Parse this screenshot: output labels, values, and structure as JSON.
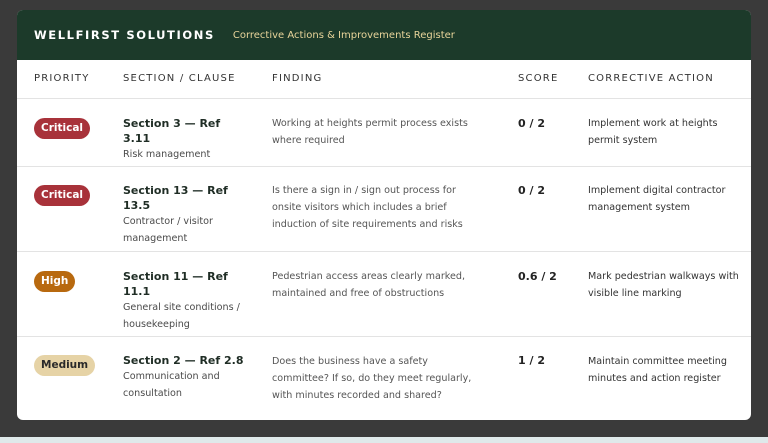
{
  "header": {
    "brand": "WELLFIRST SOLUTIONS",
    "subtitle": "Corrective Actions & Improvements Register"
  },
  "columns": {
    "priority": "PRIORITY",
    "section": "SECTION / CLAUSE",
    "finding": "FINDING",
    "score": "SCORE",
    "action": "CORRECTIVE ACTION"
  },
  "rows": [
    {
      "priority": "Critical",
      "section_title": "Section 3 — Ref 3.11",
      "section_sub": "Risk management",
      "finding": "Working at heights permit process exists where required",
      "score": "0 / 2",
      "action": "Implement work at heights permit system"
    },
    {
      "priority": "Critical",
      "section_title": "Section 13 — Ref 13.5",
      "section_sub": "Contractor / visitor management",
      "finding": "Is there a sign in / sign out process for onsite visitors which includes a brief induction of site requirements and risks",
      "score": "0 / 2",
      "action": "Implement digital contractor management system"
    },
    {
      "priority": "High",
      "section_title": "Section 11 — Ref 11.1",
      "section_sub": "General site conditions / housekeeping",
      "finding": "Pedestrian access areas clearly marked, maintained and free of obstructions",
      "score": "0.6 / 2",
      "action": "Mark pedestrian walkways with visible line marking"
    },
    {
      "priority": "Medium",
      "section_title": "Section 2 — Ref 2.8",
      "section_sub": "Communication and consultation",
      "finding": "Does the business have a safety committee? If so, do they meet regularly, with minutes recorded and shared?",
      "score": "1 / 2",
      "action": "Maintain committee meeting minutes and action register"
    }
  ],
  "colors": {
    "header_bg": "#1c3a2a",
    "critical": "#a8323a",
    "high": "#b8690f",
    "medium": "#e6d3a6"
  }
}
